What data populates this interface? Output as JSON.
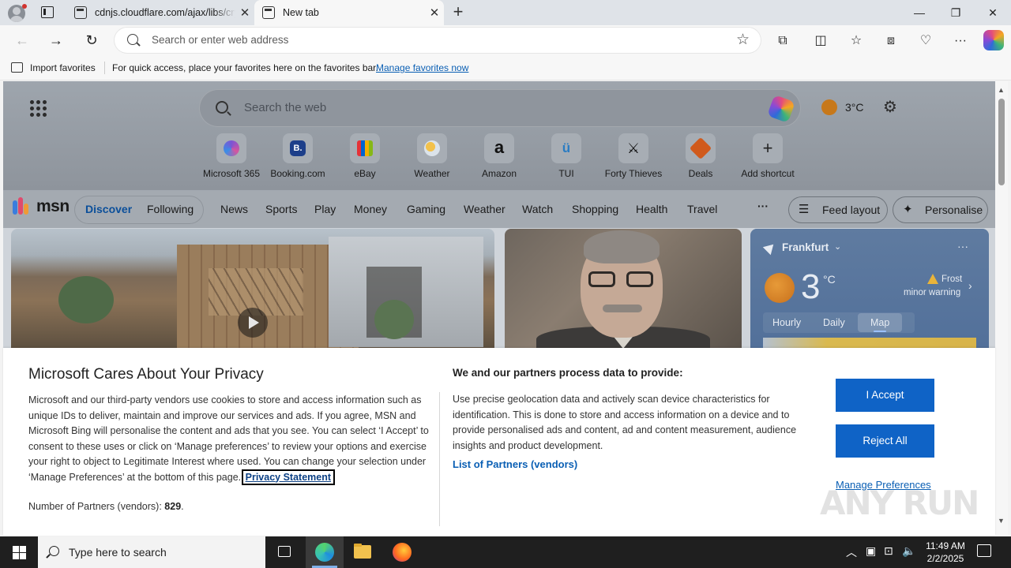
{
  "browser": {
    "tabs": [
      {
        "title": "cdnjs.cloudflare.com/ajax/libs/crypto-js",
        "close": "✕"
      },
      {
        "title": "New tab",
        "close": "✕"
      }
    ],
    "new_tab_glyph": "+",
    "window_controls": {
      "minimize": "—",
      "restore": "❐",
      "close": "✕"
    },
    "address_placeholder": "Search or enter web address",
    "favorites_bar": {
      "import_label": "Import favorites",
      "hint": "For quick access, place your favorites here on the favorites bar.",
      "manage_link": "Manage favorites now"
    }
  },
  "msn": {
    "search_placeholder": "Search the web",
    "weather_temp": "3°C",
    "shortcuts": [
      {
        "label": "Microsoft 365",
        "color": "#7b55d4"
      },
      {
        "label": "Booking.com",
        "color": "#1d3f8a",
        "glyph": "B."
      },
      {
        "label": "eBay",
        "color": "#2f3b46"
      },
      {
        "label": "Weather",
        "color": "#c9d4dd"
      },
      {
        "label": "Amazon",
        "color": "#ffffff",
        "glyph": "a"
      },
      {
        "label": "TUI",
        "color": "#6fb9e8",
        "glyph": "ü"
      },
      {
        "label": "Forty Thieves",
        "color": "#1a1a1a",
        "glyph": "⚔"
      },
      {
        "label": "Deals",
        "color": "#d05a1c"
      },
      {
        "label": "Add shortcut",
        "glyph": "+"
      }
    ],
    "logo_text": "msn",
    "nav": {
      "tabs": [
        "Discover",
        "Following"
      ],
      "active_tab": "Discover",
      "categories": [
        "News",
        "Sports",
        "Play",
        "Money",
        "Gaming",
        "Weather",
        "Watch",
        "Shopping",
        "Health",
        "Travel"
      ],
      "more": "···",
      "feed_layout": "Feed layout",
      "personalise": "Personalise"
    },
    "weather_card": {
      "location": "Frankfurt",
      "temp": "3",
      "unit": "°C",
      "warning_line1": "Frost",
      "warning_line2": "minor warning",
      "tabs": [
        "Hourly",
        "Daily",
        "Map"
      ],
      "active_tab": "Map"
    }
  },
  "privacy": {
    "title": "Microsoft Cares About Your Privacy",
    "body": "Microsoft and our third-party vendors use cookies to store and access information such as unique IDs to deliver, maintain and improve our services and ads. If you agree, MSN and Microsoft Bing will personalise the content and ads that you see. You can select ‘I Accept’ to consent to these uses or click on ‘Manage preferences’ to review your options and exercise your right to object to Legitimate Interest where used.  You can change your selection under ‘Manage Preferences’ at the bottom of this page.",
    "privacy_link": "Privacy Statement",
    "partners_label": "Number of Partners (vendors):",
    "partners_count": "829",
    "partners_suffix": ".",
    "right_title": "We and our partners process data to provide:",
    "right_body": "Use precise geolocation data and actively scan device characteristics for identification. This is done to store and access information on a device and to provide personalised ads and content, ad and content measurement, audience insights and product development.",
    "vendors_link": "List of Partners (vendors)",
    "accept": "I Accept",
    "reject": "Reject All",
    "manage": "Manage Preferences",
    "brand_color": "#0f63c6"
  },
  "watermark": "ANY RUN",
  "taskbar": {
    "search_placeholder": "Type here to search",
    "time": "11:49 AM",
    "date": "2/2/2025"
  }
}
